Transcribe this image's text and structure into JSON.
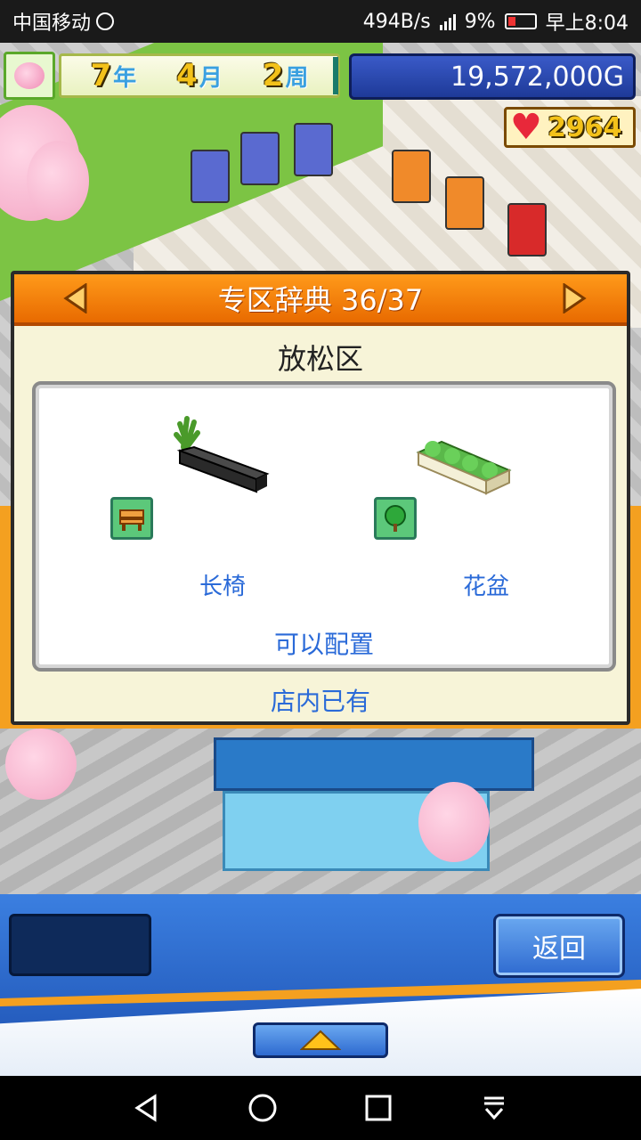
{
  "status_bar": {
    "carrier": "中国移动",
    "net_speed": "494B/s",
    "battery": "9%",
    "time": "早上8:04"
  },
  "hud": {
    "year": "7",
    "year_unit": "年",
    "month": "4",
    "month_unit": "月",
    "week": "2",
    "week_unit": "周",
    "money": "19,572,000G",
    "hearts": "2964"
  },
  "dialog": {
    "title": "专区辞典 36/37",
    "zone_name": "放松区",
    "items": [
      {
        "label": "长椅",
        "icon": "bench-icon"
      },
      {
        "label": "花盆",
        "icon": "tree-icon"
      }
    ],
    "can_place": "可以配置",
    "in_store": "店内已有"
  },
  "bottom": {
    "back_label": "返回"
  },
  "colors": {
    "header_orange": "#ff9a1a",
    "text_blue": "#2a6ad8",
    "panel_blue": "#2e6ad0"
  }
}
